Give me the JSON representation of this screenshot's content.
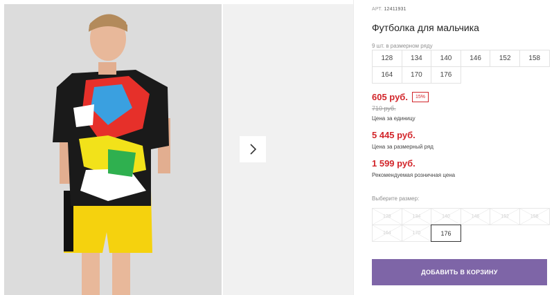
{
  "product": {
    "sku_label": "АРТ.",
    "sku": "12411931",
    "title": "Футболка для мальчика",
    "count_in_row": "9 шт. в размерном ряду",
    "row_sizes": [
      "128",
      "134",
      "140",
      "146",
      "152",
      "158",
      "164",
      "170",
      "176"
    ]
  },
  "pricing": {
    "price": "605 руб.",
    "discount": "15%",
    "old_price": "710 руб.",
    "unit_label": "Цена за единицу",
    "row_price": "5 445 руб.",
    "row_label": "Цена за размерный ряд",
    "retail_price": "1 599 руб.",
    "retail_label": "Рекомендуемая розничная цена"
  },
  "size_selector": {
    "label": "Выберите размер:",
    "options": [
      {
        "label": "128",
        "available": false
      },
      {
        "label": "134",
        "available": false
      },
      {
        "label": "140",
        "available": false
      },
      {
        "label": "146",
        "available": false
      },
      {
        "label": "152",
        "available": false
      },
      {
        "label": "158",
        "available": false
      },
      {
        "label": "164",
        "available": false
      },
      {
        "label": "170",
        "available": false
      },
      {
        "label": "176",
        "available": true,
        "selected": true
      }
    ]
  },
  "actions": {
    "add_to_cart": "ДОБАВИТЬ В КОРЗИНУ"
  },
  "gallery": {
    "next_icon": "chevron-right-icon"
  },
  "colors": {
    "accent": "#7e65a7",
    "price": "#d2252a"
  }
}
